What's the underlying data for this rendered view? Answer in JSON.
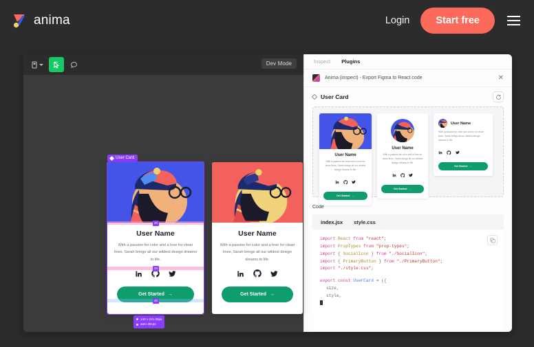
{
  "nav": {
    "brand": "anima",
    "login": "Login",
    "start_free": "Start free",
    "menu_icon": "hamburger-icon",
    "accent": "#fc6a5b",
    "bg": "#2c2c2c"
  },
  "canvas": {
    "bg": "#3b3b3b",
    "toolbar": {
      "menu_icon": "figma-menu-icon",
      "caret_icon": "chevron-down-icon",
      "move_tool_icon": "move-tool-icon",
      "comment_icon": "comment-icon",
      "active_tool": "move-tool"
    },
    "dev_mode_label": "Dev Mode",
    "selection_badge": "User Card",
    "measure_tip": [
      "140 x 221.00px",
      "auto 381px"
    ],
    "cards": [
      {
        "name": "User Name",
        "description": "With a passion for color and a love for clean lines, Sarah brings all our wildest design dreams to life.",
        "cta": "Get Started",
        "cta_arrow": "→",
        "hero_color": "#4355e8",
        "socials": [
          "linkedin-icon",
          "github-icon",
          "twitter-icon"
        ]
      },
      {
        "name": "User Name",
        "description": "With a passion for color and a love for clean lines, Sarah brings all our wildest design dreams to life.",
        "cta": "Get Started",
        "cta_arrow": "→",
        "hero_color": "#f2615c",
        "socials": [
          "linkedin-icon",
          "github-icon",
          "twitter-icon"
        ]
      }
    ]
  },
  "panel": {
    "tabs": [
      {
        "label": "Inspect",
        "active": false
      },
      {
        "label": "Plugins",
        "active": true
      }
    ],
    "plugin_title": "Anima (inspect) - Export Figma to React code",
    "close_icon": "close-icon",
    "component": {
      "icon": "component-diamond-icon",
      "name": "User Card",
      "refresh_icon": "refresh-icon"
    },
    "preview_cards": [
      {
        "name": "User Name",
        "description": "With a passion for color and a love for clean lines, Sarah brings all our wildest design dreams to life.",
        "cta": "Get Started",
        "variant": "image-top"
      },
      {
        "name": "User Name",
        "description": "With a passion for color and a love for clean lines, Sarah brings all our wildest design dreams to life.",
        "cta": "Get Started",
        "variant": "avatar-center"
      },
      {
        "name": "User Name",
        "description": "With a passion for color and a love for clean lines, Sarah brings all our wildest design dreams to life.",
        "cta": "Get Started",
        "variant": "avatar-inline"
      }
    ],
    "code_section_label": "Code",
    "code_tabs": [
      {
        "label": "index.jsx",
        "active": true
      },
      {
        "label": "style.css",
        "active": false
      }
    ],
    "copy_icon": "copy-icon",
    "code_lines": [
      {
        "tokens": [
          {
            "t": "import ",
            "c": "k-kw"
          },
          {
            "t": "React",
            "c": "k-id"
          },
          {
            "t": " from ",
            "c": "k-kw"
          },
          {
            "t": "\"react\"",
            "c": "k-str"
          },
          {
            "t": ";",
            "c": "k-pun"
          }
        ]
      },
      {
        "tokens": [
          {
            "t": "import ",
            "c": "k-kw"
          },
          {
            "t": "PropTypes",
            "c": "k-id"
          },
          {
            "t": " from ",
            "c": "k-kw"
          },
          {
            "t": "\"prop-types\"",
            "c": "k-str"
          },
          {
            "t": ";",
            "c": "k-pun"
          }
        ]
      },
      {
        "tokens": [
          {
            "t": "import ",
            "c": "k-kw"
          },
          {
            "t": "{ ",
            "c": "k-pun"
          },
          {
            "t": "SocialIcon",
            "c": "k-id"
          },
          {
            "t": " } ",
            "c": "k-pun"
          },
          {
            "t": "from ",
            "c": "k-kw"
          },
          {
            "t": "\"./SocialIcon\"",
            "c": "k-str"
          },
          {
            "t": ";",
            "c": "k-pun"
          }
        ]
      },
      {
        "tokens": [
          {
            "t": "import ",
            "c": "k-kw"
          },
          {
            "t": "{ ",
            "c": "k-pun"
          },
          {
            "t": "PrimaryButton",
            "c": "k-id"
          },
          {
            "t": " } ",
            "c": "k-pun"
          },
          {
            "t": "from ",
            "c": "k-kw"
          },
          {
            "t": "\"./PrimaryButton\"",
            "c": "k-str"
          },
          {
            "t": ";",
            "c": "k-pun"
          }
        ]
      },
      {
        "tokens": [
          {
            "t": "import ",
            "c": "k-kw"
          },
          {
            "t": "\"./style.css\"",
            "c": "k-str"
          },
          {
            "t": ";",
            "c": "k-pun"
          }
        ]
      },
      {
        "blank": true
      },
      {
        "tokens": [
          {
            "t": "export ",
            "c": "k-kw"
          },
          {
            "t": "const ",
            "c": "k-kw"
          },
          {
            "t": "UserCard",
            "c": "k-comp"
          },
          {
            "t": " = ({",
            "c": "k-pun"
          }
        ]
      },
      {
        "indent": 1,
        "tokens": [
          {
            "t": "size,",
            "c": "k-pun"
          }
        ]
      },
      {
        "indent": 1,
        "tokens": [
          {
            "t": "style,",
            "c": "k-pun"
          }
        ]
      },
      {
        "cursor": true
      }
    ]
  }
}
